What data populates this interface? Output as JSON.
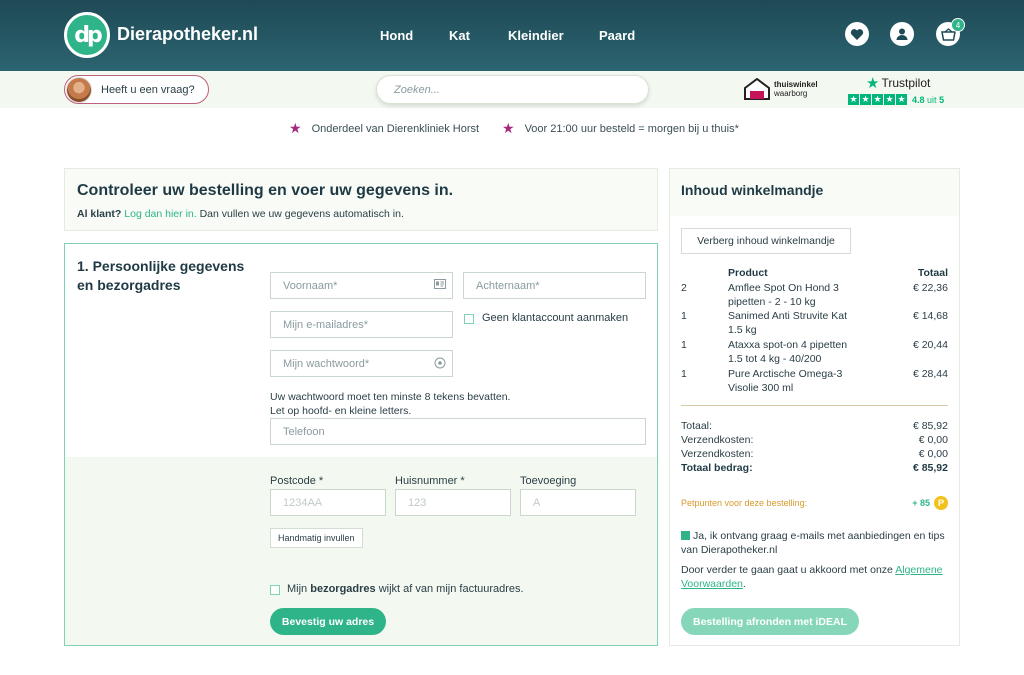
{
  "header": {
    "brand": "Dierapotheker.nl",
    "logo_icon": "dp-logo-icon",
    "nav": [
      "Hond",
      "Kat",
      "Kleindier",
      "Paard"
    ],
    "cart_count": "4",
    "icons": [
      "heart-icon",
      "user-icon",
      "basket-icon"
    ]
  },
  "subbar": {
    "question_label": "Heeft u een vraag?",
    "search_placeholder": "Zoeken...",
    "thuiswinkel_line1": "thuiswinkel",
    "thuiswinkel_line2": "waarborg",
    "trustpilot_label": "Trustpilot",
    "trustpilot_score": "4.8",
    "trustpilot_of": "uit",
    "trustpilot_max": "5",
    "trustpilot_rating": 4.8
  },
  "usp": [
    "Onderdeel van Dierenkliniek Horst",
    "Voor 21:00 uur besteld = morgen bij u thuis*"
  ],
  "intro": {
    "title": "Controleer uw bestelling en voer uw gegevens in.",
    "customer_prefix": "Al klant?",
    "login_link": "Log dan hier in.",
    "customer_suffix": "Dan vullen we uw gegevens automatisch in."
  },
  "form": {
    "section_title": "1. Persoonlijke gegevens en bezorgadres",
    "firstname_placeholder": "Voornaam*",
    "lastname_placeholder": "Achternaam*",
    "email_placeholder": "Mijn e-mailadres*",
    "no_account_label": "Geen klantaccount aanmaken",
    "password_placeholder": "Mijn wachtwoord*",
    "password_hint_1": "Uw wachtwoord moet ten minste 8 tekens bevatten.",
    "password_hint_2": "Let op hoofd- en kleine letters.",
    "phone_placeholder": "Telefoon",
    "postcode_label": "Postcode *",
    "postcode_placeholder": "1234AA",
    "housenumber_label": "Huisnummer *",
    "housenumber_placeholder": "123",
    "addition_label": "Toevoeging",
    "addition_placeholder": "A",
    "manual_button": "Handmatig invullen",
    "delivery_prefix": "Mijn",
    "delivery_bold": "bezorgadres",
    "delivery_suffix": "wijkt af van mijn factuuradres.",
    "confirm_button": "Bevestig uw adres"
  },
  "cart": {
    "title": "Inhoud winkelmandje",
    "toggle_button": "Verberg inhoud winkelmandje",
    "col_product": "Product",
    "col_total": "Totaal",
    "items": [
      {
        "qty": "2",
        "name_1": "Amflee Spot On Hond 3",
        "name_2": "pipetten - 2 - 10 kg",
        "price": "€ 22,36"
      },
      {
        "qty": "1",
        "name_1": "Sanimed Anti Struvite Kat",
        "name_2": "1.5 kg",
        "price": "€ 14,68"
      },
      {
        "qty": "1",
        "name_1": "Ataxxa spot-on 4 pipetten",
        "name_2": "1.5 tot 4 kg - 40/200",
        "price": "€ 20,44"
      },
      {
        "qty": "1",
        "name_1": "Pure Arctische Omega-3",
        "name_2": "Visolie 300 ml",
        "price": "€ 28,44"
      }
    ],
    "summary": [
      {
        "label": "Totaal:",
        "value": "€ 85,92"
      },
      {
        "label": "Verzendkosten:",
        "value": "€ 0,00"
      },
      {
        "label": "Verzendkosten:",
        "value": "€ 0,00"
      }
    ],
    "grand_total_label": "Totaal bedrag:",
    "grand_total_value": "€ 85,92",
    "points_label": "Petpunten voor deze bestelling:",
    "points_value": "+ 85",
    "points_coin": "P",
    "newsletter_label": "Ja, ik ontvang graag e-mails met aanbiedingen en tips van Dierapotheker.nl",
    "terms_text": "Door verder te gaan gaat u akkoord met onze",
    "terms_link": "Algemene Voorwaarden",
    "terms_end": ".",
    "checkout_button": "Bestelling afronden met iDEAL"
  },
  "colors": {
    "header": "#1e4a56",
    "accent": "#2fb48a",
    "usp_star": "#a52a7e",
    "trustpilot": "#00b67a"
  }
}
